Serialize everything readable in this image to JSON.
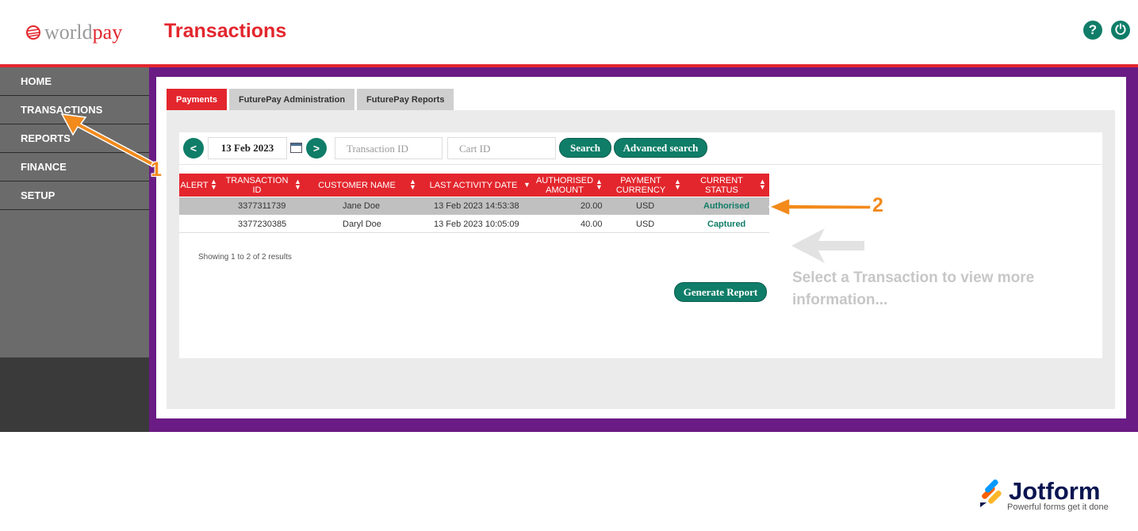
{
  "header": {
    "logo_world": "world",
    "logo_pay": "pay",
    "title": "Transactions",
    "help_icon": "?",
    "power_icon": "⏻"
  },
  "sidebar": {
    "items": [
      {
        "label": "HOME"
      },
      {
        "label": "TRANSACTIONS"
      },
      {
        "label": "REPORTS"
      },
      {
        "label": "FINANCE"
      },
      {
        "label": "SETUP"
      }
    ]
  },
  "tabs": [
    {
      "label": "Payments",
      "active": true
    },
    {
      "label": "FuturePay Administration",
      "active": false
    },
    {
      "label": "FuturePay Reports",
      "active": false
    }
  ],
  "search": {
    "prev_label": "<",
    "date": "13 Feb 2023",
    "next_label": ">",
    "transaction_id_placeholder": "Transaction ID",
    "cart_id_placeholder": "Cart ID",
    "search_label": "Search",
    "advanced_label": "Advanced search"
  },
  "table": {
    "columns": [
      "ALERT",
      "TRANSACTION ID",
      "CUSTOMER NAME",
      "LAST ACTIVITY DATE",
      "AUTHORISED AMOUNT",
      "PAYMENT CURRENCY",
      "CURRENT STATUS"
    ],
    "rows": [
      {
        "alert": "",
        "transaction_id": "3377311739",
        "customer_name": "Jane Doe",
        "last_activity": "13 Feb 2023 14:53:38",
        "amount": "20.00",
        "currency": "USD",
        "status": "Authorised",
        "selected": true
      },
      {
        "alert": "",
        "transaction_id": "3377230385",
        "customer_name": "Daryl Doe",
        "last_activity": "13 Feb 2023 10:05:09",
        "amount": "40.00",
        "currency": "USD",
        "status": "Captured",
        "selected": false
      }
    ],
    "showing": "Showing 1 to 2 of 2 results"
  },
  "generate_report_label": "Generate Report",
  "hint": "Select a Transaction to view more information...",
  "annotations": {
    "one": "1",
    "two": "2"
  },
  "footer": {
    "brand": "Jotform",
    "tagline": "Powerful forms get it done"
  },
  "colors": {
    "brand_red": "#e3262d",
    "teal": "#0f7d68",
    "purple": "#6a1b84",
    "annotation_orange": "#f28a1c"
  }
}
